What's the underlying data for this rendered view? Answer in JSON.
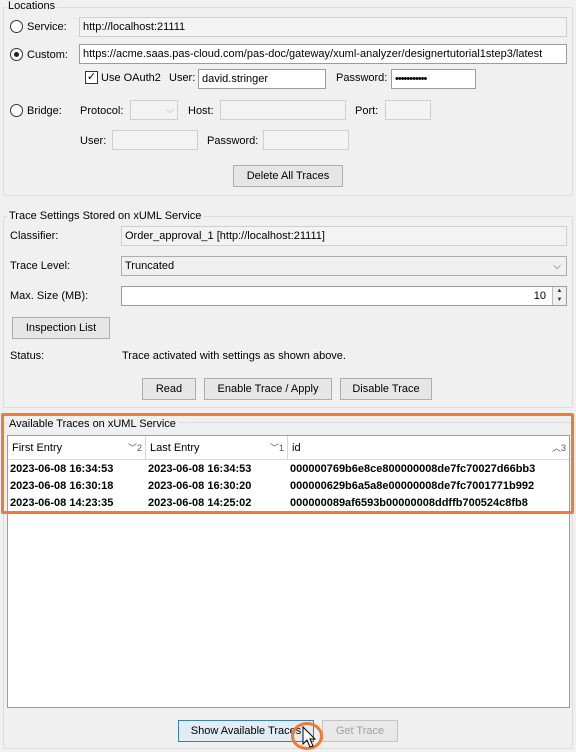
{
  "locations": {
    "legend": "Locations",
    "service": {
      "label": "Service:",
      "value": "http://localhost:21111",
      "checked": false
    },
    "custom": {
      "label": "Custom:",
      "value": "https://acme.saas.pas-cloud.com/pas-doc/gateway/xuml-analyzer/designertutorial1step3/latest",
      "checked": true
    },
    "oauth": {
      "label": "Use OAuth2",
      "checked": true
    },
    "user_label": "User:",
    "user_value": "david.stringer",
    "password_label": "Password:",
    "password_value": "•••••••••••",
    "bridge": {
      "label": "Bridge:",
      "checked": false,
      "protocol_label": "Protocol:",
      "host_label": "Host:",
      "port_label": "Port:",
      "user_label": "User:",
      "password_label": "Password:"
    },
    "delete_button": "Delete All Traces"
  },
  "trace_settings": {
    "legend": "Trace Settings Stored on xUML Service",
    "classifier_label": "Classifier:",
    "classifier_value": "Order_approval_1 [http://localhost:21111]",
    "trace_level_label": "Trace Level:",
    "trace_level_value": "Truncated",
    "max_size_label": "Max. Size (MB):",
    "max_size_value": "10",
    "inspection_button": "Inspection List",
    "status_label": "Status:",
    "status_value": "Trace activated with settings as shown above.",
    "read_button": "Read",
    "enable_button": "Enable Trace / Apply",
    "disable_button": "Disable Trace"
  },
  "available_traces": {
    "legend": "Available Traces on xUML Service",
    "columns": [
      {
        "label": "First Entry",
        "sort": "﹀2"
      },
      {
        "label": "Last Entry",
        "sort": "﹀1"
      },
      {
        "label": "id",
        "sort": "︿3"
      }
    ],
    "rows": [
      [
        "2023-06-08 16:34:53",
        "2023-06-08 16:34:53",
        "000000769b6e8ce800000008de7fc70027d66bb3"
      ],
      [
        "2023-06-08 16:30:18",
        "2023-06-08 16:30:20",
        "000000629b6a5a8e00000008de7fc7001771b992"
      ],
      [
        "2023-06-08 14:23:35",
        "2023-06-08 14:25:02",
        "000000089af6593b00000008ddffb700524c8fb8"
      ]
    ],
    "show_button": "Show Available Traces",
    "get_button": "Get Trace"
  },
  "colors": {
    "highlight": "#f07c33",
    "accent": "#3c7fb1"
  }
}
